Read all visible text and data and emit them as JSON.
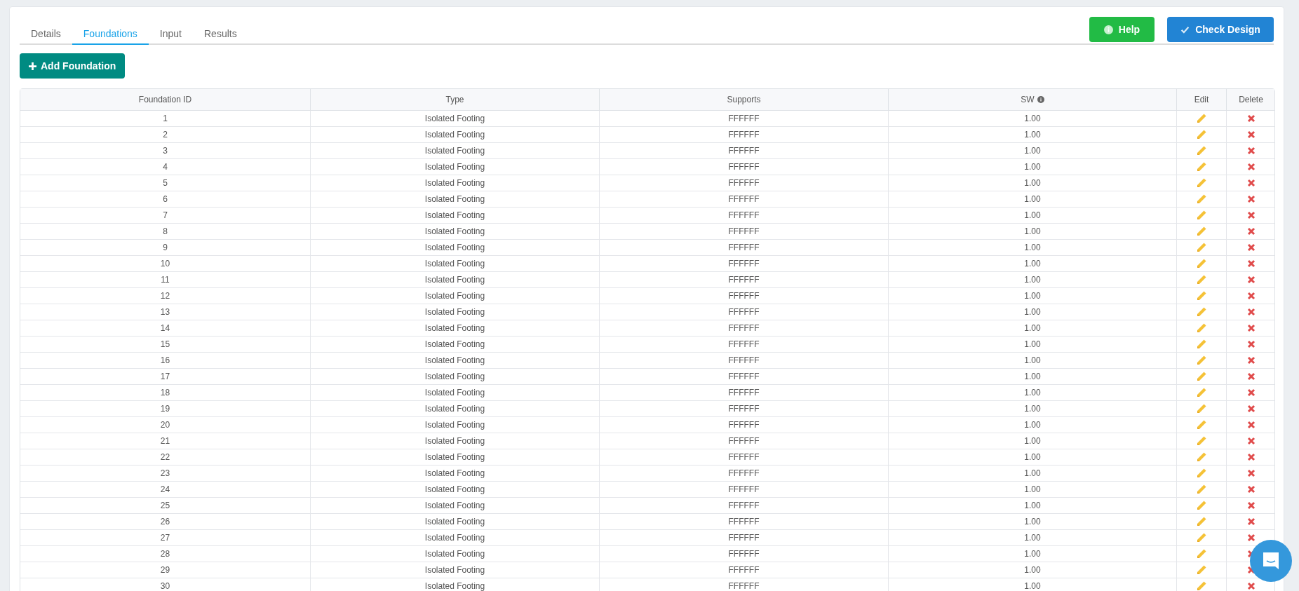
{
  "tabs": [
    {
      "label": "Details",
      "selected": false
    },
    {
      "label": "Foundations",
      "selected": true
    },
    {
      "label": "Input",
      "selected": false
    },
    {
      "label": "Results",
      "selected": false
    }
  ],
  "actions": [
    {
      "kind": "help",
      "label": "Help"
    },
    {
      "kind": "check",
      "label": "Check Design"
    }
  ],
  "add_button": {
    "label": "Add Foundation"
  },
  "table": {
    "columns": [
      "Foundation ID",
      "Type",
      "Supports",
      "SW",
      "Edit",
      "Delete"
    ],
    "rows": [
      {
        "id": "1",
        "type": "Isolated Footing",
        "supports": "FFFFFF",
        "sw": "1.00"
      },
      {
        "id": "2",
        "type": "Isolated Footing",
        "supports": "FFFFFF",
        "sw": "1.00"
      },
      {
        "id": "3",
        "type": "Isolated Footing",
        "supports": "FFFFFF",
        "sw": "1.00"
      },
      {
        "id": "4",
        "type": "Isolated Footing",
        "supports": "FFFFFF",
        "sw": "1.00"
      },
      {
        "id": "5",
        "type": "Isolated Footing",
        "supports": "FFFFFF",
        "sw": "1.00"
      },
      {
        "id": "6",
        "type": "Isolated Footing",
        "supports": "FFFFFF",
        "sw": "1.00"
      },
      {
        "id": "7",
        "type": "Isolated Footing",
        "supports": "FFFFFF",
        "sw": "1.00"
      },
      {
        "id": "8",
        "type": "Isolated Footing",
        "supports": "FFFFFF",
        "sw": "1.00"
      },
      {
        "id": "9",
        "type": "Isolated Footing",
        "supports": "FFFFFF",
        "sw": "1.00"
      },
      {
        "id": "10",
        "type": "Isolated Footing",
        "supports": "FFFFFF",
        "sw": "1.00"
      },
      {
        "id": "11",
        "type": "Isolated Footing",
        "supports": "FFFFFF",
        "sw": "1.00"
      },
      {
        "id": "12",
        "type": "Isolated Footing",
        "supports": "FFFFFF",
        "sw": "1.00"
      },
      {
        "id": "13",
        "type": "Isolated Footing",
        "supports": "FFFFFF",
        "sw": "1.00"
      },
      {
        "id": "14",
        "type": "Isolated Footing",
        "supports": "FFFFFF",
        "sw": "1.00"
      },
      {
        "id": "15",
        "type": "Isolated Footing",
        "supports": "FFFFFF",
        "sw": "1.00"
      },
      {
        "id": "16",
        "type": "Isolated Footing",
        "supports": "FFFFFF",
        "sw": "1.00"
      },
      {
        "id": "17",
        "type": "Isolated Footing",
        "supports": "FFFFFF",
        "sw": "1.00"
      },
      {
        "id": "18",
        "type": "Isolated Footing",
        "supports": "FFFFFF",
        "sw": "1.00"
      },
      {
        "id": "19",
        "type": "Isolated Footing",
        "supports": "FFFFFF",
        "sw": "1.00"
      },
      {
        "id": "20",
        "type": "Isolated Footing",
        "supports": "FFFFFF",
        "sw": "1.00"
      },
      {
        "id": "21",
        "type": "Isolated Footing",
        "supports": "FFFFFF",
        "sw": "1.00"
      },
      {
        "id": "22",
        "type": "Isolated Footing",
        "supports": "FFFFFF",
        "sw": "1.00"
      },
      {
        "id": "23",
        "type": "Isolated Footing",
        "supports": "FFFFFF",
        "sw": "1.00"
      },
      {
        "id": "24",
        "type": "Isolated Footing",
        "supports": "FFFFFF",
        "sw": "1.00"
      },
      {
        "id": "25",
        "type": "Isolated Footing",
        "supports": "FFFFFF",
        "sw": "1.00"
      },
      {
        "id": "26",
        "type": "Isolated Footing",
        "supports": "FFFFFF",
        "sw": "1.00"
      },
      {
        "id": "27",
        "type": "Isolated Footing",
        "supports": "FFFFFF",
        "sw": "1.00"
      },
      {
        "id": "28",
        "type": "Isolated Footing",
        "supports": "FFFFFF",
        "sw": "1.00"
      },
      {
        "id": "29",
        "type": "Isolated Footing",
        "supports": "FFFFFF",
        "sw": "1.00"
      },
      {
        "id": "30",
        "type": "Isolated Footing",
        "supports": "FFFFFF",
        "sw": "1.00"
      }
    ]
  }
}
